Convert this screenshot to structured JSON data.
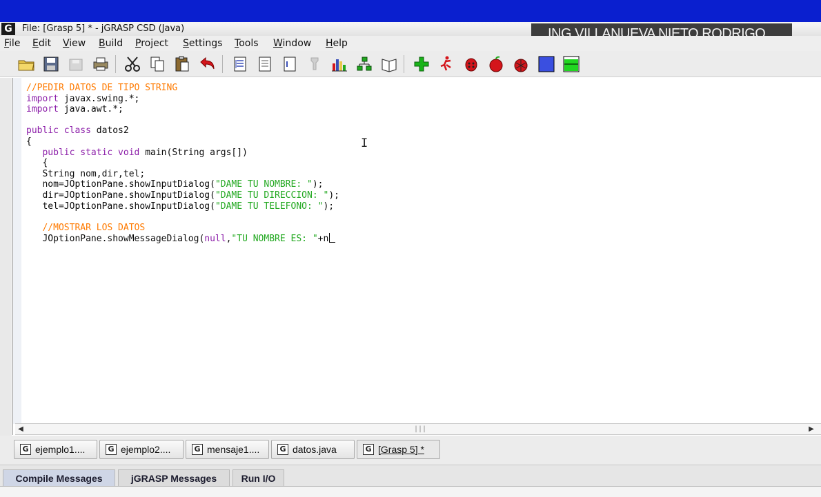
{
  "window": {
    "title": "File: [Grasp 5] * - jGRASP CSD (Java)",
    "logo_letter": "G",
    "overlay_caption": "ING VILLANUEVA NIETO RODRIGO"
  },
  "menu": [
    "File",
    "Edit",
    "View",
    "Build",
    "Project",
    "Settings",
    "Tools",
    "Window",
    "Help"
  ],
  "toolbar_icons": [
    "open-folder-icon",
    "save-icon",
    "save-all-icon",
    "print-icon",
    "cut-icon",
    "copy-icon",
    "paste-icon",
    "undo-icon",
    "generate-csd-icon",
    "remove-csd-icon",
    "fold-icon",
    "unfold-icon",
    "uml-icon",
    "class-tree-icon",
    "documentation-icon",
    "compile-icon",
    "run-icon",
    "debug-icon",
    "run-applet-icon",
    "debug-applet-icon",
    "blue-window-icon",
    "green-window-icon"
  ],
  "code": {
    "lines": [
      [
        {
          "t": "//PEDIR DATOS DE TIPO STRING",
          "c": "cm"
        }
      ],
      [
        {
          "t": "import",
          "c": "kw"
        },
        {
          "t": " javax.swing.*;",
          "c": ""
        }
      ],
      [
        {
          "t": "import",
          "c": "kw"
        },
        {
          "t": " java.awt.*;",
          "c": ""
        }
      ],
      [],
      [
        {
          "t": "public class",
          "c": "kw"
        },
        {
          "t": " datos2",
          "c": ""
        }
      ],
      [
        {
          "t": "{",
          "c": ""
        }
      ],
      [
        {
          "t": "   ",
          "c": ""
        },
        {
          "t": "public static void",
          "c": "kw"
        },
        {
          "t": " main(String args[])",
          "c": ""
        }
      ],
      [
        {
          "t": "   {",
          "c": ""
        }
      ],
      [
        {
          "t": "   String nom,dir,tel;",
          "c": ""
        }
      ],
      [
        {
          "t": "   nom=JOptionPane.showInputDialog(",
          "c": ""
        },
        {
          "t": "\"DAME TU NOMBRE: \"",
          "c": "str"
        },
        {
          "t": ");",
          "c": ""
        }
      ],
      [
        {
          "t": "   dir=JOptionPane.showInputDialog(",
          "c": ""
        },
        {
          "t": "\"DAME TU DIRECCION: \"",
          "c": "str"
        },
        {
          "t": ");",
          "c": ""
        }
      ],
      [
        {
          "t": "   tel=JOptionPane.showInputDialog(",
          "c": ""
        },
        {
          "t": "\"DAME TU TELEFONO: \"",
          "c": "str"
        },
        {
          "t": ");",
          "c": ""
        }
      ],
      [],
      [
        {
          "t": "   //MOSTRAR LOS DATOS",
          "c": "cm"
        }
      ],
      [
        {
          "t": "   JOptionPane.showMessageDialog(",
          "c": ""
        },
        {
          "t": "null",
          "c": "kw"
        },
        {
          "t": ",",
          "c": ""
        },
        {
          "t": "\"TU NOMBRE ES: \"",
          "c": "str"
        },
        {
          "t": "+n",
          "c": ""
        }
      ]
    ]
  },
  "tabs": [
    {
      "label": "ejemplo1....",
      "active": false
    },
    {
      "label": "ejemplo2....",
      "active": false
    },
    {
      "label": "mensaje1....",
      "active": false
    },
    {
      "label": "datos.java",
      "active": false
    },
    {
      "label": "[Grasp 5] *",
      "active": true
    }
  ],
  "message_tabs": [
    "Compile Messages",
    "jGRASP Messages",
    "Run I/O"
  ],
  "message_tab_active": "Compile Messages",
  "colors": {
    "comment": "#ff7a00",
    "keyword": "#8b1ca8",
    "string": "#21a81f",
    "title_band": "#0a1fcf"
  }
}
